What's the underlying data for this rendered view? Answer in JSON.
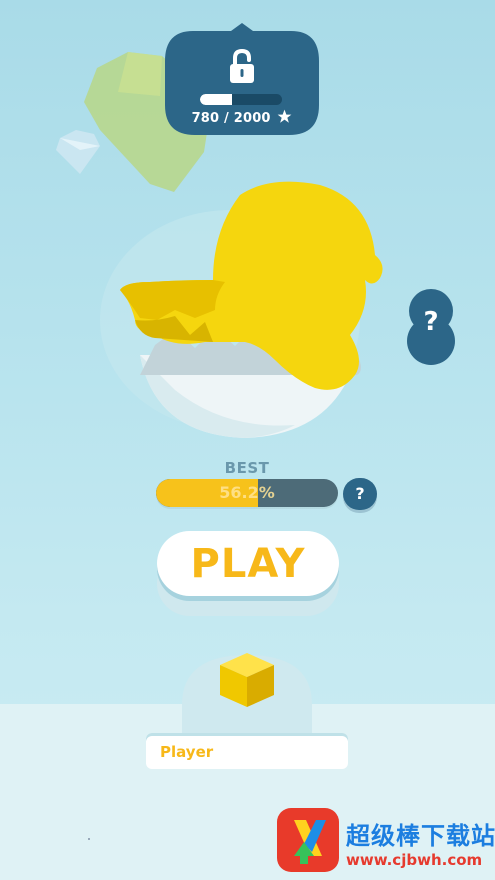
{
  "unlock": {
    "lock_icon": "padlock-open-icon",
    "progress_current": 780,
    "progress_target": 2000,
    "progress_fraction": 0.39,
    "progress_text": "780 / 2000",
    "star_icon": "star-icon"
  },
  "side_help": {
    "label": "?"
  },
  "best": {
    "label": "BEST",
    "value_text": "56.2%",
    "value_fraction": 0.562,
    "help_label": "?"
  },
  "play": {
    "label": "PLAY"
  },
  "skin": {
    "icon": "yellow-cube-icon"
  },
  "player": {
    "name": "Player"
  },
  "watermark": {
    "title": "超级棒下载站",
    "url": "www.cjbwh.com"
  },
  "colors": {
    "accent_yellow": "#f7c21b",
    "panel_blue": "#2c6688",
    "background": "#b9e4ee"
  }
}
